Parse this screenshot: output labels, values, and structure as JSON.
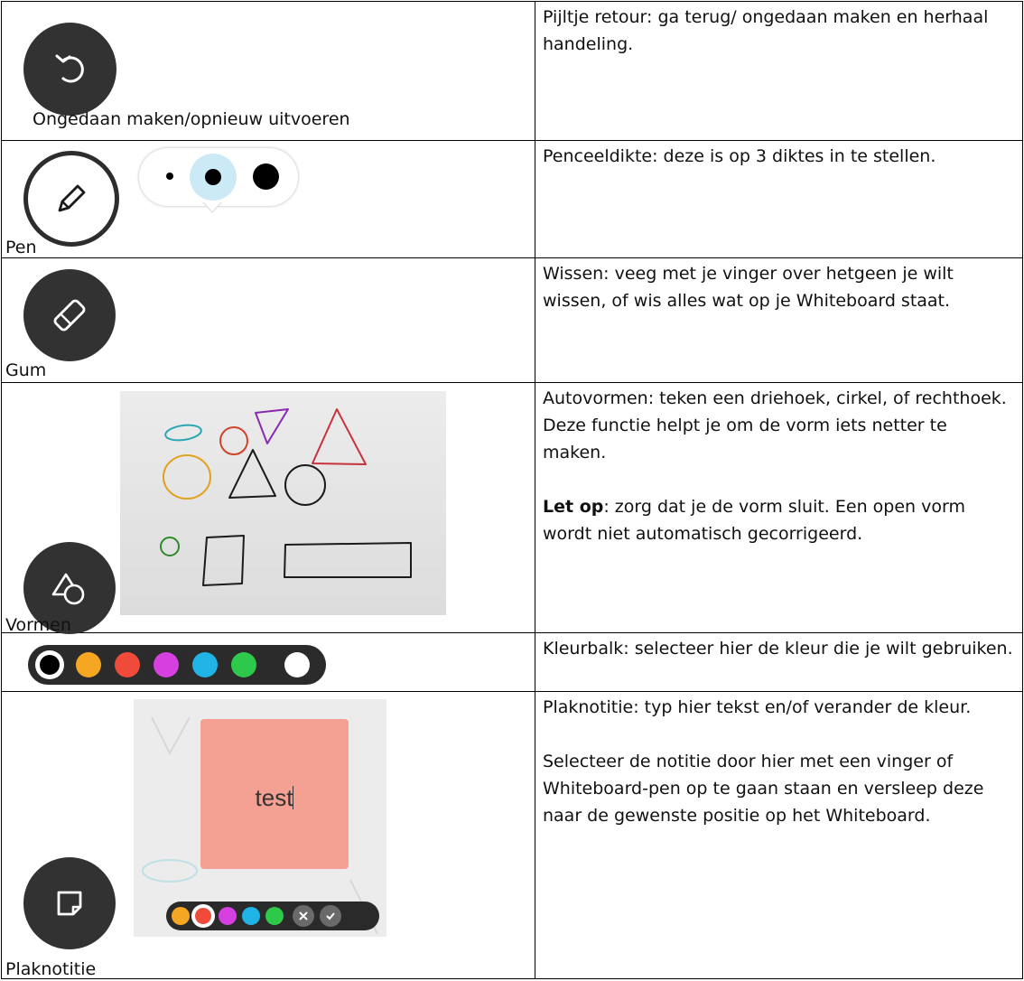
{
  "rows": [
    {
      "icon": "undo-icon",
      "caption": "Ongedaan maken/opnieuw uitvoeren",
      "paragraphs": [
        {
          "text": "Pijltje retour: ga terug/ ongedaan maken en herhaal handeling."
        }
      ]
    },
    {
      "icon": "pencil-icon",
      "caption": "Pen",
      "paragraphs": [
        {
          "text": "Penceeldikte: deze is op 3 diktes in te stellen."
        }
      ]
    },
    {
      "icon": "eraser-icon",
      "caption": "Gum",
      "paragraphs": [
        {
          "text": "Wissen: veeg met je vinger over hetgeen je wilt wissen, of wis alles wat op je Whiteboard staat."
        }
      ]
    },
    {
      "icon": "shapes-icon",
      "caption": "Vormen",
      "paragraphs": [
        {
          "text": "Autovormen: teken een driehoek, cirkel, of rechthoek. Deze functie helpt je om de vorm iets netter te maken."
        },
        {
          "bold": "Let op",
          "text": ": zorg dat je de vorm sluit. Een open vorm wordt niet automatisch gecorrigeerd."
        }
      ]
    },
    {
      "icon": "color-bar",
      "caption": "",
      "colors": [
        "#000000",
        "#f5a623",
        "#f04a3a",
        "#d63fe0",
        "#1fb3e6",
        "#2ec94a",
        "#ffffff"
      ],
      "paragraphs": [
        {
          "text": "Kleurbalk: selecteer hier de kleur die je wilt gebruiken."
        }
      ]
    },
    {
      "icon": "sticky-note-icon",
      "caption": "Plaknotitie",
      "note_text": "test",
      "paragraphs": [
        {
          "text": "Plaknotitie: typ hier tekst en/of verander de kleur."
        },
        {
          "text": "Selecteer de notitie door hier met een vinger of Whiteboard-pen op te gaan staan en versleep deze naar de gewenste positie op het Whiteboard."
        }
      ]
    }
  ]
}
